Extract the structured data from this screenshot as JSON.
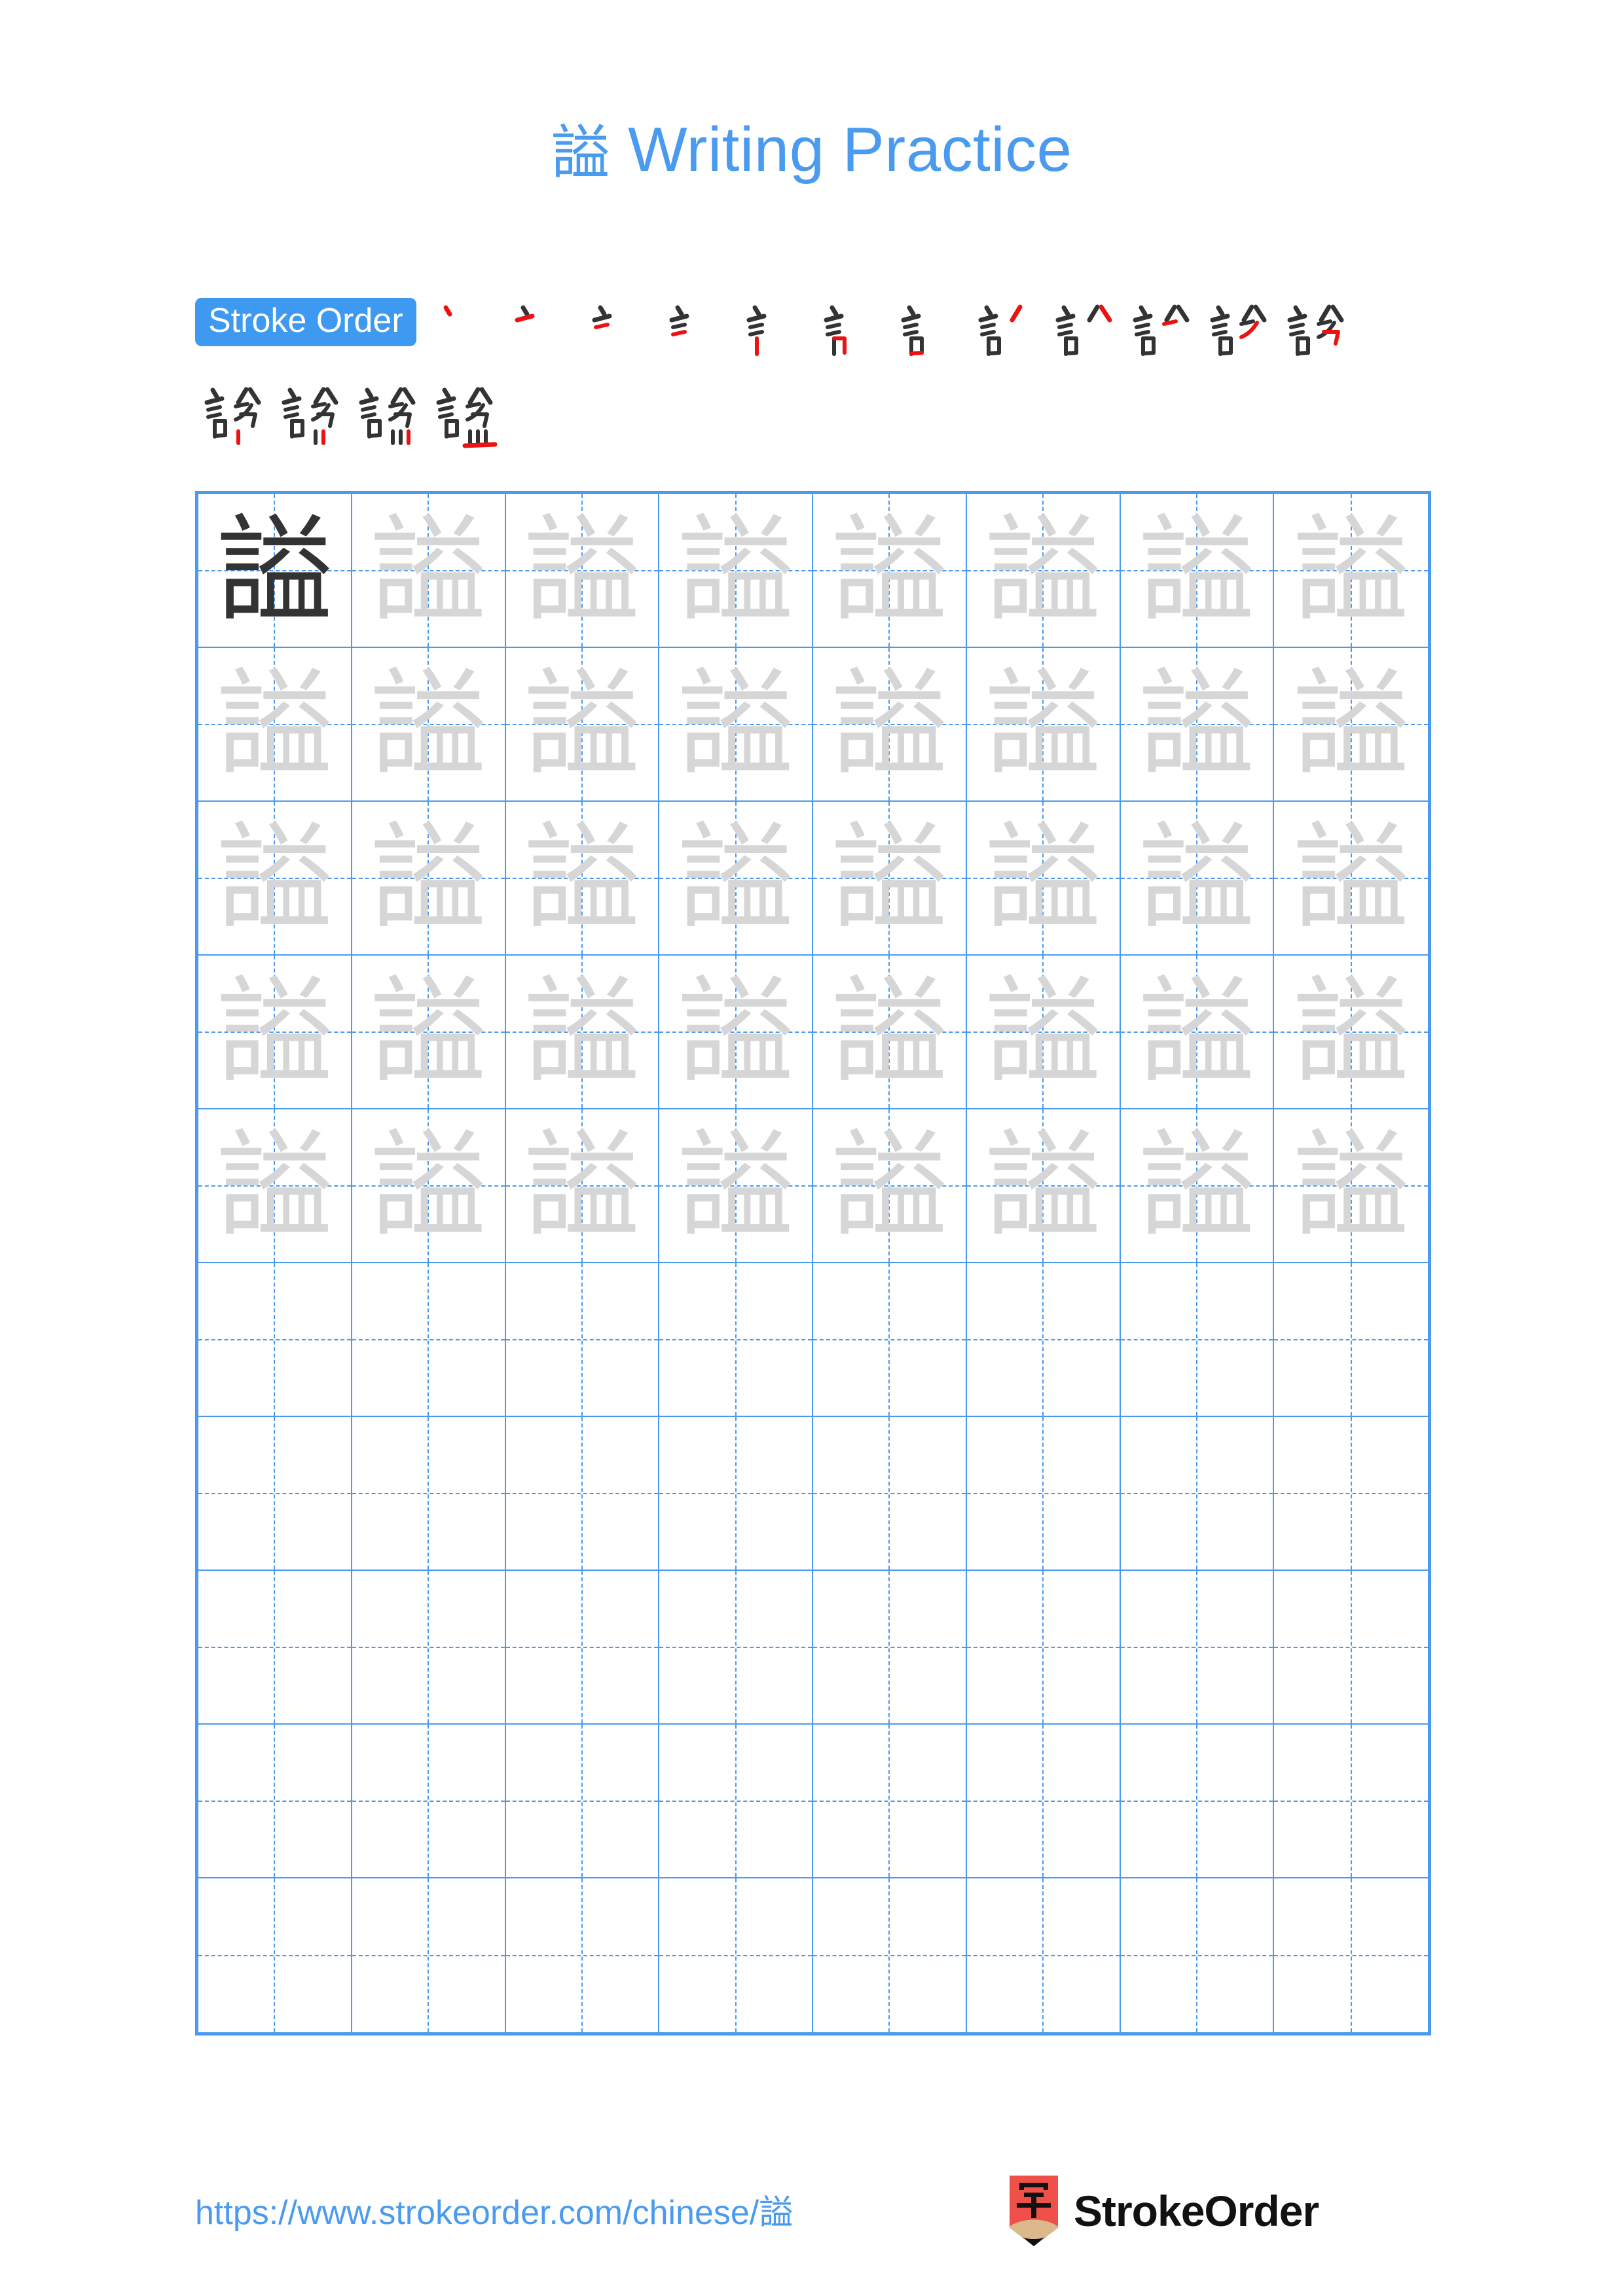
{
  "character": "謚",
  "title": {
    "character": "謚",
    "suffix": " Writing Practice",
    "full": "謚 Writing Practice",
    "color": "#4a9bf0"
  },
  "stroke_order": {
    "badge_label": "Stroke Order",
    "badge_bg": "#3d9af0",
    "badge_text_color": "#ffffff",
    "total_strokes": 16,
    "ink_color": "#333333",
    "new_stroke_color": "#ee1111",
    "row1_count": 12,
    "row2_count": 4,
    "steps": [
      {
        "index": 1,
        "partial": "丶"
      },
      {
        "index": 2,
        "partial": "亠"
      },
      {
        "index": 3,
        "partial": "三"
      },
      {
        "index": 4,
        "partial": "㇀"
      },
      {
        "index": 5,
        "partial": "言"
      },
      {
        "index": 6,
        "partial": "言"
      },
      {
        "index": 7,
        "partial": "言"
      },
      {
        "index": 8,
        "partial": "言"
      },
      {
        "index": 9,
        "partial": "訁"
      },
      {
        "index": 10,
        "partial": "訟"
      },
      {
        "index": 11,
        "partial": "診"
      },
      {
        "index": 12,
        "partial": "詥"
      },
      {
        "index": 13,
        "partial": "諂"
      },
      {
        "index": 14,
        "partial": "謚"
      },
      {
        "index": 15,
        "partial": "謚"
      },
      {
        "index": 16,
        "partial": "謚"
      }
    ]
  },
  "grid": {
    "columns": 8,
    "rows": 10,
    "border_color": "#4a9bf0",
    "guide_line_color": "#4a9bf0",
    "model_color": "#333333",
    "trace_color": "#d6d6d6",
    "cells": [
      [
        "model",
        "trace",
        "trace",
        "trace",
        "trace",
        "trace",
        "trace",
        "trace"
      ],
      [
        "trace",
        "trace",
        "trace",
        "trace",
        "trace",
        "trace",
        "trace",
        "trace"
      ],
      [
        "trace",
        "trace",
        "trace",
        "trace",
        "trace",
        "trace",
        "trace",
        "trace"
      ],
      [
        "trace",
        "trace",
        "trace",
        "trace",
        "trace",
        "trace",
        "trace",
        "trace"
      ],
      [
        "trace",
        "trace",
        "trace",
        "trace",
        "trace",
        "trace",
        "trace",
        "trace"
      ],
      [
        "blank",
        "blank",
        "blank",
        "blank",
        "blank",
        "blank",
        "blank",
        "blank"
      ],
      [
        "blank",
        "blank",
        "blank",
        "blank",
        "blank",
        "blank",
        "blank",
        "blank"
      ],
      [
        "blank",
        "blank",
        "blank",
        "blank",
        "blank",
        "blank",
        "blank",
        "blank"
      ],
      [
        "blank",
        "blank",
        "blank",
        "blank",
        "blank",
        "blank",
        "blank",
        "blank"
      ],
      [
        "blank",
        "blank",
        "blank",
        "blank",
        "blank",
        "blank",
        "blank",
        "blank"
      ]
    ]
  },
  "footer": {
    "url": "https://www.strokeorder.com/chinese/謚",
    "url_color": "#4a9bf0",
    "brand_name": "StrokeOrder",
    "logo_character": "字",
    "logo_bg": "#f0504a",
    "logo_pencil_tan": "#dbb98c",
    "logo_tip": "#111111"
  }
}
